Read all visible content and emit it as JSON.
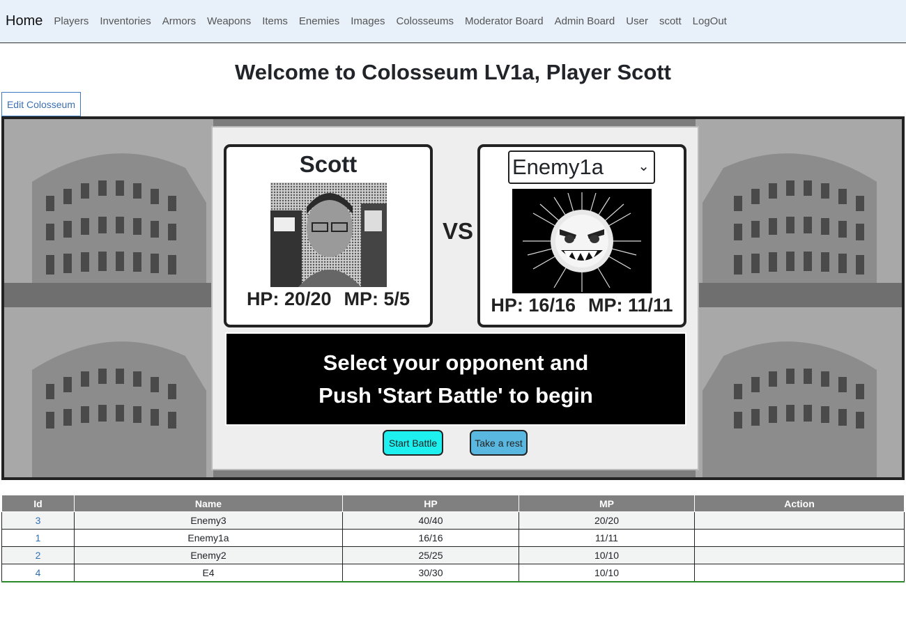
{
  "nav": {
    "brand": "Home",
    "items": [
      "Players",
      "Inventories",
      "Armors",
      "Weapons",
      "Items",
      "Enemies",
      "Images",
      "Colosseums",
      "Moderator Board",
      "Admin Board",
      "User",
      "scott",
      "LogOut"
    ]
  },
  "page_title": "Welcome to Colosseum LV1a, Player Scott",
  "edit_button": "Edit Colosseum",
  "player": {
    "name": "Scott",
    "hp_text": "HP: 20/20",
    "mp_text": "MP: 5/5"
  },
  "vs": "VS",
  "enemy": {
    "selected": "Enemy1a",
    "hp_text": "HP: 16/16",
    "mp_text": "MP: 11/11"
  },
  "message": {
    "line1": "Select your opponent and",
    "line2": "Push 'Start Battle' to begin"
  },
  "buttons": {
    "start": "Start Battle",
    "rest": "Take a rest"
  },
  "table": {
    "headers": [
      "Id",
      "Name",
      "HP",
      "MP",
      "Action"
    ],
    "rows": [
      {
        "id": "3",
        "name": "Enemy3",
        "hp": "40/40",
        "mp": "20/20",
        "action": ""
      },
      {
        "id": "1",
        "name": "Enemy1a",
        "hp": "16/16",
        "mp": "11/11",
        "action": ""
      },
      {
        "id": "2",
        "name": "Enemy2",
        "hp": "25/25",
        "mp": "10/10",
        "action": ""
      },
      {
        "id": "4",
        "name": "E4",
        "hp": "30/30",
        "mp": "10/10",
        "action": ""
      }
    ]
  },
  "colors": {
    "start_button": "#1ef0f0",
    "rest_button": "#5ab8e0",
    "table_header": "#808080",
    "link": "#2f6fb5"
  }
}
